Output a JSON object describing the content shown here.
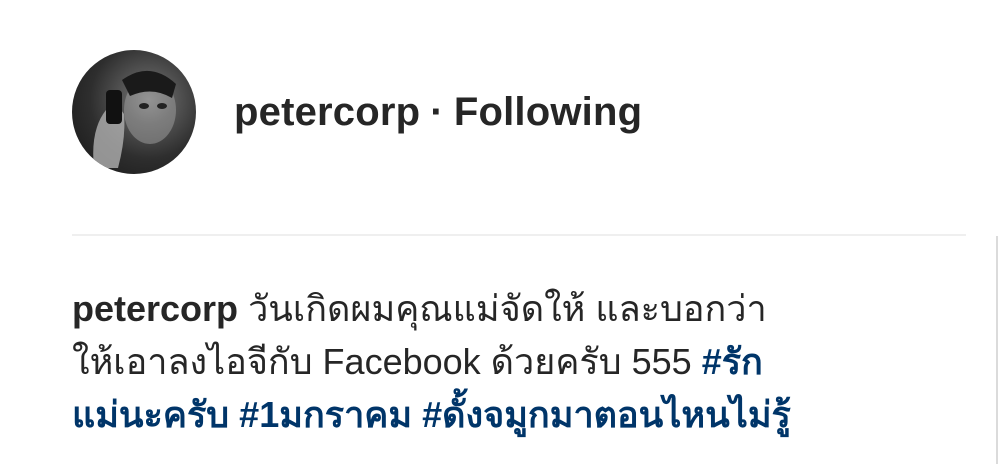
{
  "post": {
    "username": "petercorp",
    "separator": "·",
    "follow_status": "Following"
  },
  "caption": {
    "username": "petercorp",
    "line1_text": "วันเกิดผมคุณแม่จัดให้ และบอกว่า",
    "line2_text": "ให้เอาลงไอจีกับ Facebook ด้วยครับ 555",
    "hashtag1_part1": "#รัก",
    "hashtag1_part2": "แม่นะครับ",
    "hashtag2": "#1มกราคม",
    "hashtag3": "#ดั้งจมูกมาตอนไหนไม่รู้"
  },
  "colors": {
    "text": "#262626",
    "hashtag": "#003569",
    "divider": "#efefef"
  }
}
